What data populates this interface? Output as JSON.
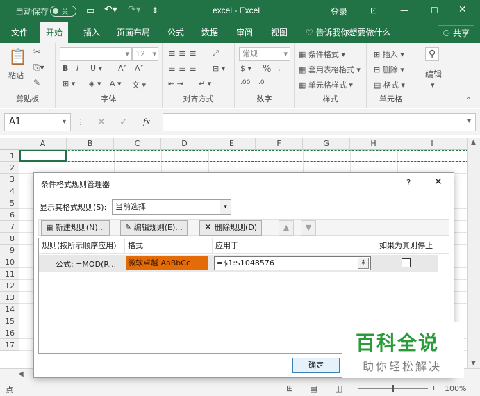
{
  "titlebar": {
    "autosave": "自动保存",
    "autosave_state": "关",
    "doc_title": "excel  -  Excel",
    "login": "登录"
  },
  "tabs": {
    "file": "文件",
    "home": "开始",
    "insert": "插入",
    "page_layout": "页面布局",
    "formulas": "公式",
    "data": "数据",
    "review": "审阅",
    "view": "视图",
    "tell_me": "告诉我你想要做什么",
    "share": "共享"
  },
  "ribbon": {
    "paste": "粘贴",
    "clipboard": "剪贴板",
    "font_size": "12",
    "font": "字体",
    "alignment": "对齐方式",
    "number_format": "常规",
    "number": "数字",
    "conditional_format": "条件格式",
    "format_as_table": "套用表格格式",
    "cell_styles": "单元格样式",
    "styles": "样式",
    "insert": "插入",
    "delete": "删除",
    "format": "格式",
    "cells": "单元格",
    "editing": "编辑"
  },
  "formula_bar": {
    "name_box": "A1",
    "fx": "fx",
    "formula": ""
  },
  "sheet": {
    "columns": [
      "A",
      "B",
      "C",
      "D",
      "E",
      "F",
      "G",
      "H",
      "I"
    ],
    "rows": [
      "1",
      "2",
      "3",
      "4",
      "5",
      "6",
      "7",
      "8",
      "9",
      "10",
      "11",
      "12",
      "13",
      "14",
      "15",
      "16",
      "17"
    ]
  },
  "dialog": {
    "title": "条件格式规则管理器",
    "help": "?",
    "close": "✕",
    "show_rules_label": "显示其格式规则(S):",
    "show_rules_value": "当前选择",
    "new_rule": "新建规则(N)...",
    "edit_rule": "编辑规则(E)...",
    "delete_rule": "删除规则(D)",
    "col_rule": "规则(按所示顺序应用)",
    "col_format": "格式",
    "col_applies": "应用于",
    "col_stop": "如果为真则停止",
    "rule_text": "公式: =MOD(R...",
    "format_preview": "微软卓越  AaBbCc",
    "applies_to": "=$1:$1048576",
    "ok": "确定"
  },
  "status": {
    "mode": "点",
    "zoom": "100%"
  },
  "watermark": {
    "line1": "百科全说",
    "line2": "助你轻松解决"
  },
  "colors": {
    "excel_green": "#217346",
    "format_preview_bg": "#e36c09",
    "watermark_green": "#2a9b3a"
  }
}
